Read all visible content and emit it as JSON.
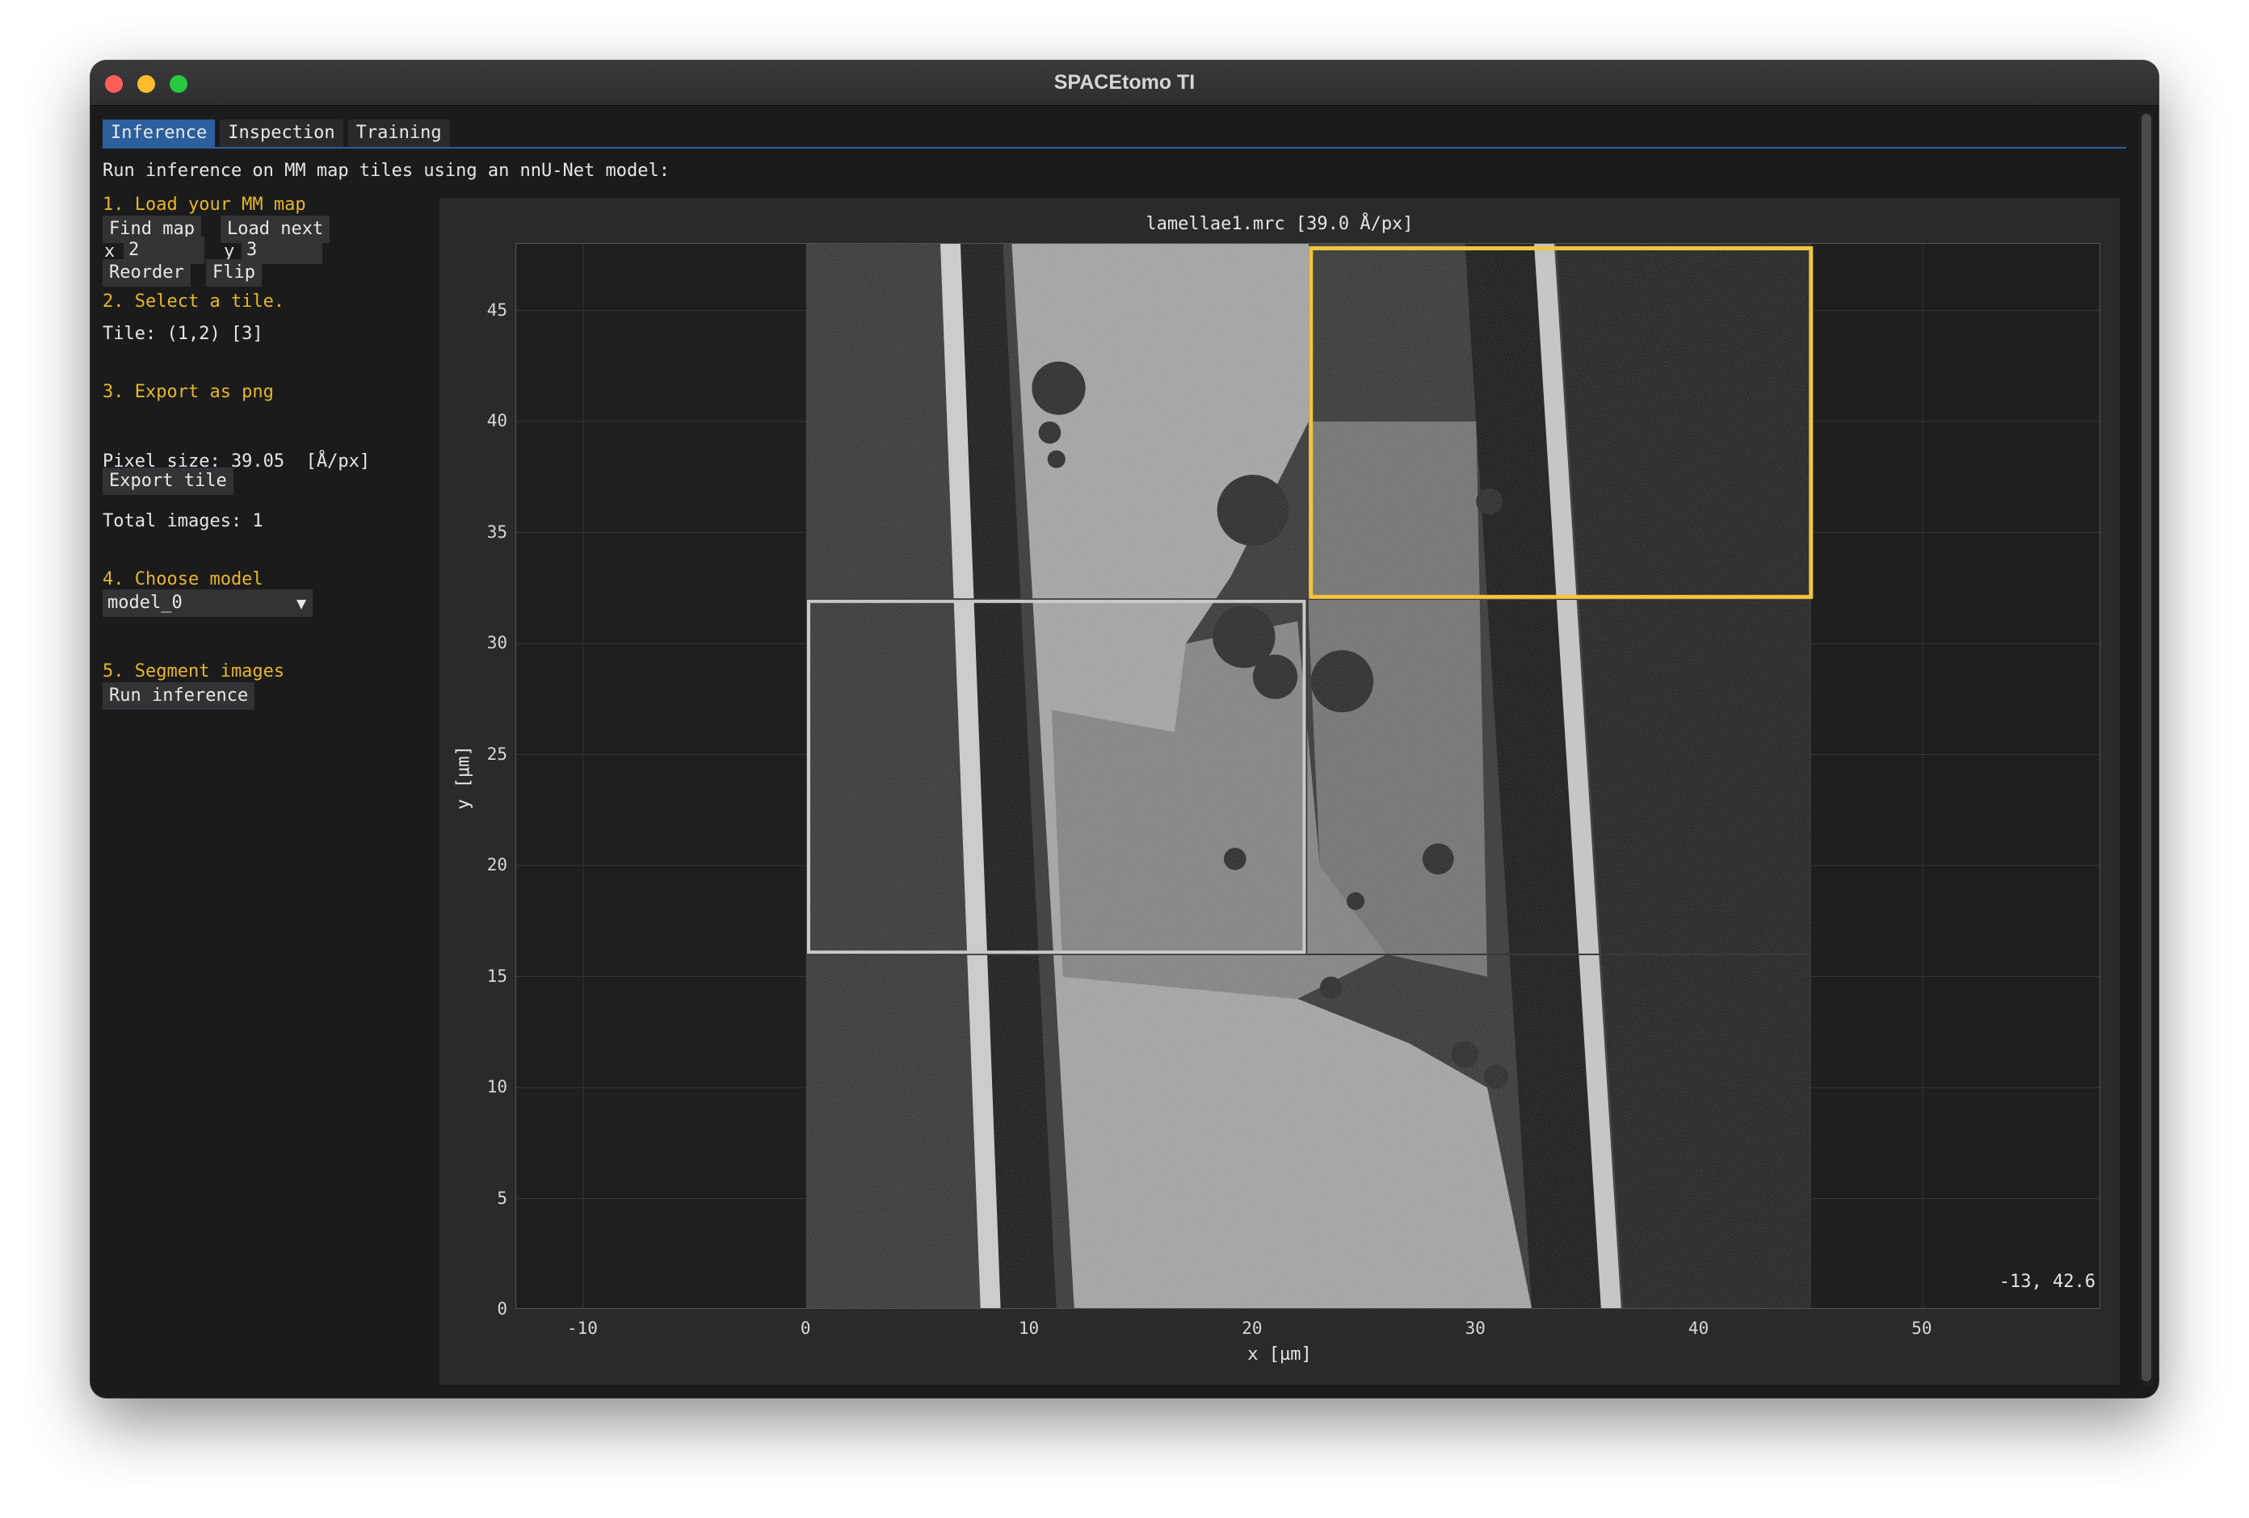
{
  "window": {
    "title": "SPACEtomo TI"
  },
  "tabs": [
    "Inference",
    "Inspection",
    "Training"
  ],
  "intro": "Run inference on MM map tiles using an nnU-Net model:",
  "sidebar": {
    "step1": {
      "heading": "1. Load your MM map",
      "find_map": "Find map",
      "load_next": "Load next",
      "x_label": "x",
      "x_value": "2",
      "y_label": "y",
      "y_value": "3",
      "reorder": "Reorder",
      "flip": "Flip"
    },
    "step2": {
      "heading": "2. Select a tile.",
      "tile_info": "Tile: (1,2) [3]"
    },
    "step3": {
      "heading": "3. Export as png",
      "pixel_size": "Pixel size: 39.05  [Å/px]",
      "export_tile": "Export tile",
      "total_images": "Total images: 1"
    },
    "step4": {
      "heading": "4. Choose model",
      "model_selected": "model_0"
    },
    "step5": {
      "heading": "5. Segment images",
      "run_inference": "Run inference"
    }
  },
  "plot": {
    "title": "lamellae1.mrc [39.0 Å/px]",
    "xlabel": "x [µm]",
    "ylabel": "y [µm]",
    "xlim": [
      -13,
      58
    ],
    "ylim": [
      0,
      48
    ],
    "xticks": [
      -10,
      0,
      10,
      20,
      30,
      40,
      50
    ],
    "yticks": [
      0,
      5,
      10,
      15,
      20,
      25,
      30,
      35,
      40,
      45
    ],
    "cursor_readout": "-13, 42.6",
    "grid": "3 columns x 3 rows of image tiles",
    "highlight_colors": {
      "selected": "#f2c53d",
      "hover": "#c9c9c9"
    }
  }
}
